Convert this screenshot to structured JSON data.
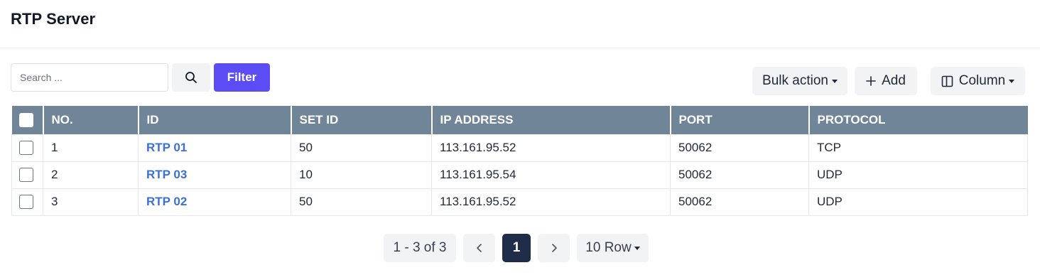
{
  "page": {
    "title": "RTP Server"
  },
  "toolbar": {
    "search_placeholder": "Search ...",
    "search_icon": "search-icon",
    "filter_label": "Filter",
    "bulk_action_label": "Bulk action",
    "add_label": "Add",
    "add_icon": "plus-icon",
    "column_label": "Column",
    "column_icon": "columns-icon"
  },
  "colors": {
    "accent": "#5b4cf5",
    "header_bg": "#718599",
    "link": "#3b6fd8",
    "active_page": "#1f2d48"
  },
  "table": {
    "columns": [
      "NO.",
      "ID",
      "SET ID",
      "IP ADDRESS",
      "PORT",
      "PROTOCOL"
    ],
    "rows": [
      {
        "no": "1",
        "id": "RTP 01",
        "set_id": "50",
        "ip": "113.161.95.52",
        "port": "50062",
        "protocol": "TCP"
      },
      {
        "no": "2",
        "id": "RTP 03",
        "set_id": "10",
        "ip": "113.161.95.54",
        "port": "50062",
        "protocol": "UDP"
      },
      {
        "no": "3",
        "id": "RTP 02",
        "set_id": "50",
        "ip": "113.161.95.52",
        "port": "50062",
        "protocol": "UDP"
      }
    ]
  },
  "pagination": {
    "info": "1 - 3 of 3",
    "current_page": "1",
    "rows_per_page": "10 Row"
  }
}
